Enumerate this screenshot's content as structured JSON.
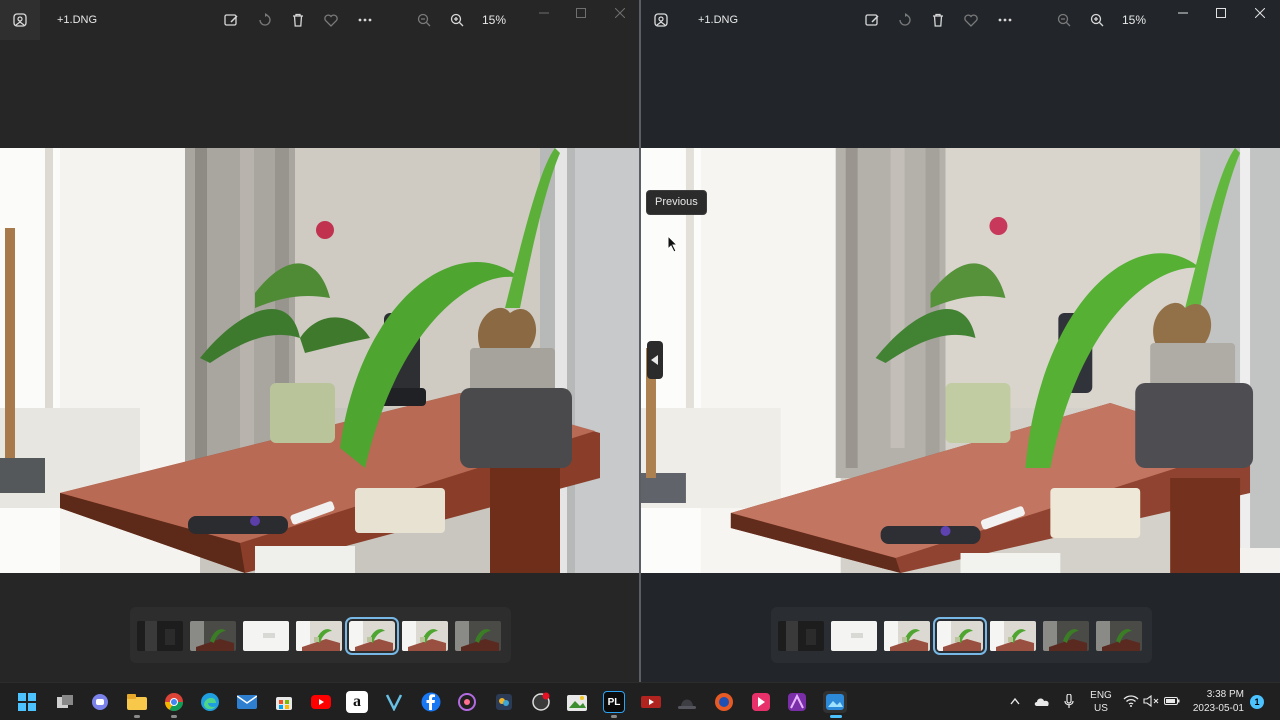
{
  "left_window": {
    "title": "+1.DNG",
    "zoom": "15%",
    "thumbnails": [
      {
        "style": "dark"
      },
      {
        "style": "plant-dark"
      },
      {
        "style": "white"
      },
      {
        "style": "plant-light"
      },
      {
        "style": "plant-light",
        "selected": true
      },
      {
        "style": "plant-light"
      },
      {
        "style": "plant-dark"
      }
    ]
  },
  "right_window": {
    "title": "+1.DNG",
    "zoom": "15%",
    "tooltip": "Previous",
    "thumbnails": [
      {
        "style": "dark"
      },
      {
        "style": "white"
      },
      {
        "style": "plant-light"
      },
      {
        "style": "plant-light",
        "selected": true
      },
      {
        "style": "plant-light"
      },
      {
        "style": "plant-dark"
      },
      {
        "style": "plant-dark"
      }
    ]
  },
  "toolbar_icons": [
    "edit-icon",
    "rotate-icon",
    "delete-icon",
    "favorite-icon",
    "more-icon",
    "zoom-out-icon",
    "zoom-in-icon"
  ],
  "taskbar": {
    "apps": [
      "start-icon",
      "task-view-icon",
      "teams-chat-icon",
      "file-explorer-icon",
      "chrome-icon",
      "edge-icon",
      "mail-icon",
      "store-icon",
      "youtube-icon",
      "amazon-icon",
      "vectorworks-icon",
      "facebook-icon",
      "app-icon",
      "color-icon",
      "davinci-icon",
      "photo-editor-icon",
      "pycharm-icon",
      "media-icon",
      "hat-icon",
      "app-icon-2",
      "video-icon",
      "affinity-icon",
      "photos-icon"
    ],
    "amazon_letter": "a",
    "language": [
      "ENG",
      "US"
    ],
    "time": "3:38 PM",
    "date": "2023-05-01",
    "notification_count": "1",
    "colors": {
      "active_indicator": "#4cc2ff"
    }
  }
}
